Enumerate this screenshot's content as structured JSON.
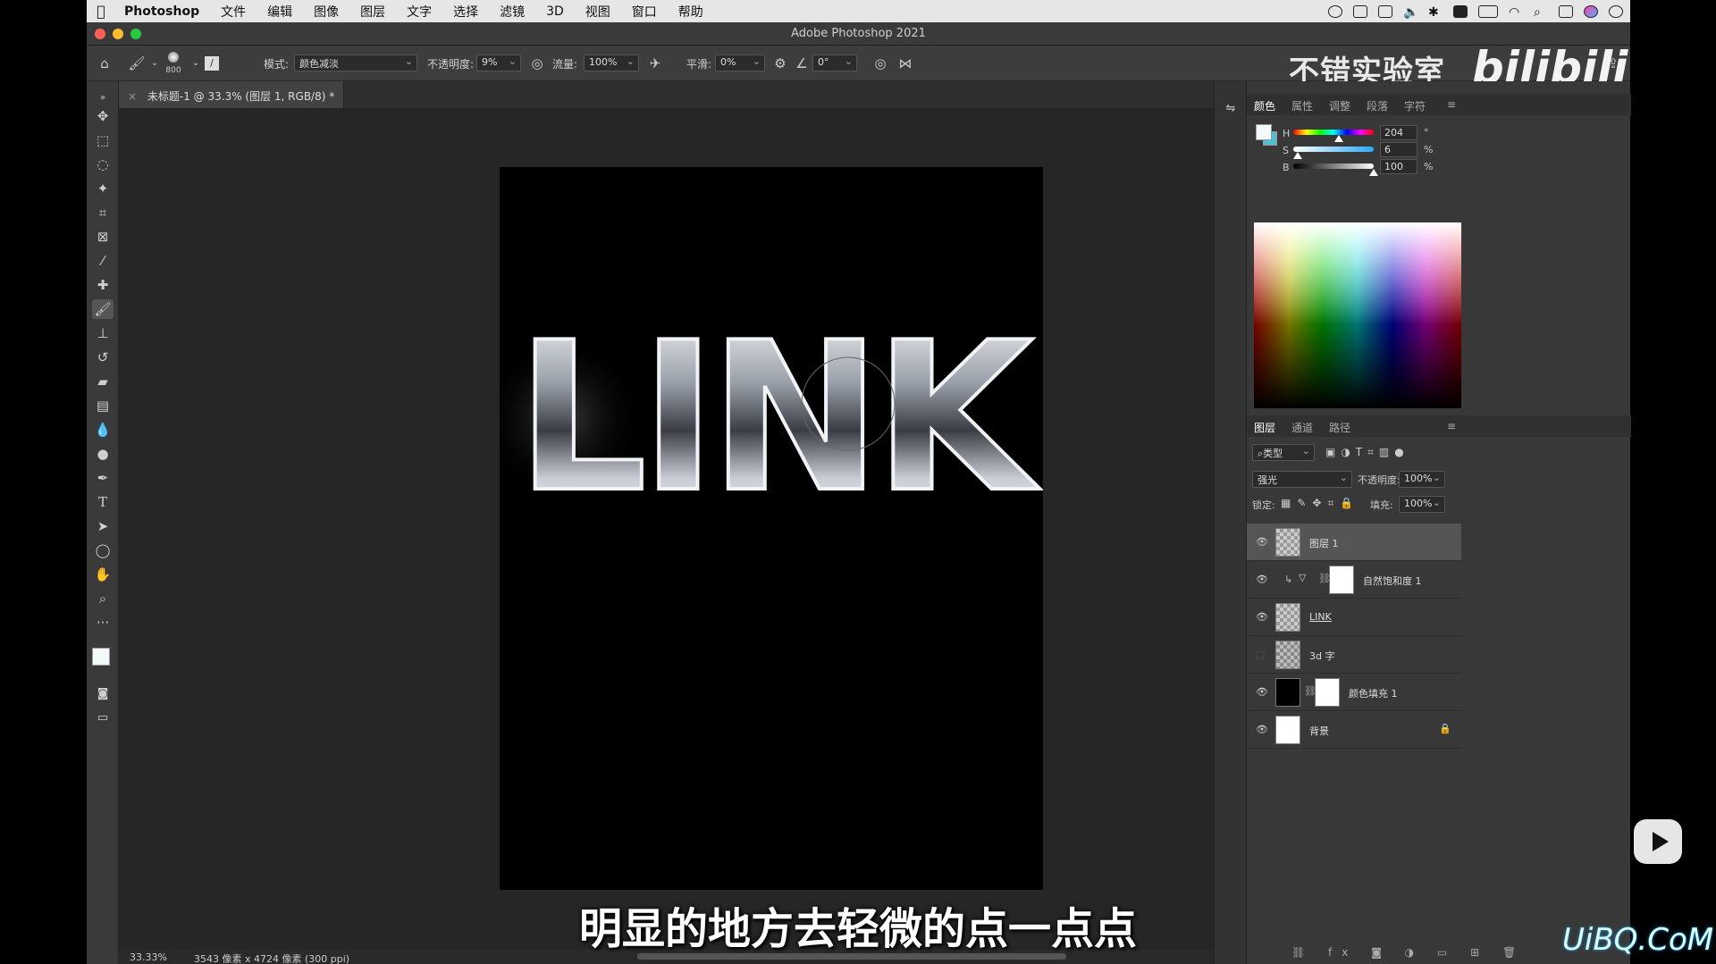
{
  "menubar": {
    "app": "Photoshop",
    "items": [
      "文件",
      "编辑",
      "图像",
      "图层",
      "文字",
      "选择",
      "滤镜",
      "3D",
      "视图",
      "窗口",
      "帮助"
    ]
  },
  "window": {
    "title": "Adobe Photoshop 2021"
  },
  "options": {
    "brush_size": "800",
    "mode_label": "模式:",
    "mode_value": "颜色减淡",
    "opacity_label": "不透明度:",
    "opacity_value": "9%",
    "flow_label": "流量:",
    "flow_value": "100%",
    "smooth_label": "平滑:",
    "smooth_value": "0%",
    "angle_value": "0°"
  },
  "watermark": {
    "channel": "不错实验室",
    "brand": "bilibili",
    "site": "UiBQ.CoM"
  },
  "document": {
    "tab_title": "未标题-1 @ 33.3% (图层 1, RGB/8) *",
    "artwork_text": "LINK"
  },
  "status": {
    "zoom": "33.33%",
    "info": "3543 像素 x 4724 像素 (300 ppi)"
  },
  "color_panel": {
    "tabs": [
      "颜色",
      "属性",
      "调整",
      "段落",
      "字符"
    ],
    "h_label": "H",
    "h_value": "204",
    "h_unit": "°",
    "s_label": "S",
    "s_value": "6",
    "s_unit": "%",
    "b_label": "B",
    "b_value": "100",
    "b_unit": "%",
    "h_level": 0.567,
    "s_level": 0.06,
    "b_level": 1.0
  },
  "layers_panel": {
    "tabs": [
      "图层",
      "通道",
      "路径"
    ],
    "filter": "类型",
    "blend_mode": "强光",
    "opacity_label": "不透明度:",
    "opacity_value": "100%",
    "lock_label": "锁定:",
    "fill_label": "填充:",
    "fill_value": "100%",
    "layers": [
      "图层 1",
      "自然饱和度 1",
      "LINK",
      "3d 字",
      "颜色填充 1",
      "背景"
    ]
  },
  "subtitle": "明显的地方去轻微的点一点点",
  "colors": {
    "accent": "#0a84ff",
    "panel": "#383838",
    "canvas": "#262626"
  }
}
